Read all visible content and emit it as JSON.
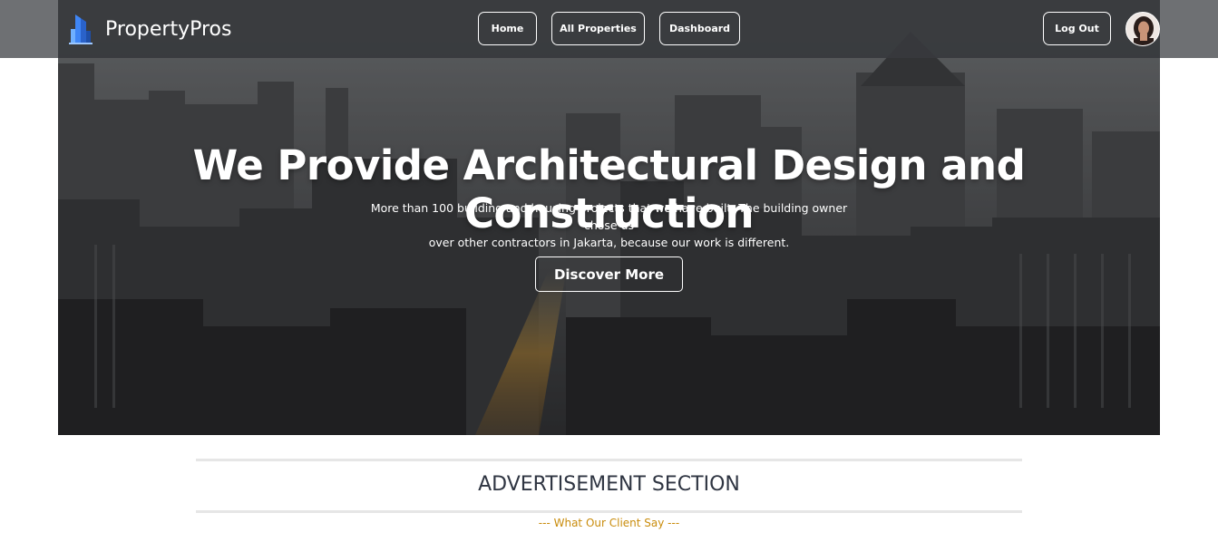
{
  "brand": {
    "name": "PropertyPros",
    "logo_icon": "building-logo-icon"
  },
  "nav": {
    "home": "Home",
    "all_properties": "All Properties",
    "dashboard": "Dashboard",
    "logout": "Log Out"
  },
  "hero": {
    "title": "We Provide Architectural Design and Construction",
    "subtitle_line1": "More than 100 building and housing projects that we have built. The building owner chose us",
    "subtitle_line2": "over other contractors in Jakarta, because our work is different.",
    "cta": "Discover More"
  },
  "advertisement": {
    "title": "ADVERTISEMENT SECTION",
    "subtitle": "--- What Our Client Say ---"
  },
  "colors": {
    "accent_gold": "#c98c0c",
    "navbar": "#4e5054",
    "title_text": "#2f3542"
  }
}
